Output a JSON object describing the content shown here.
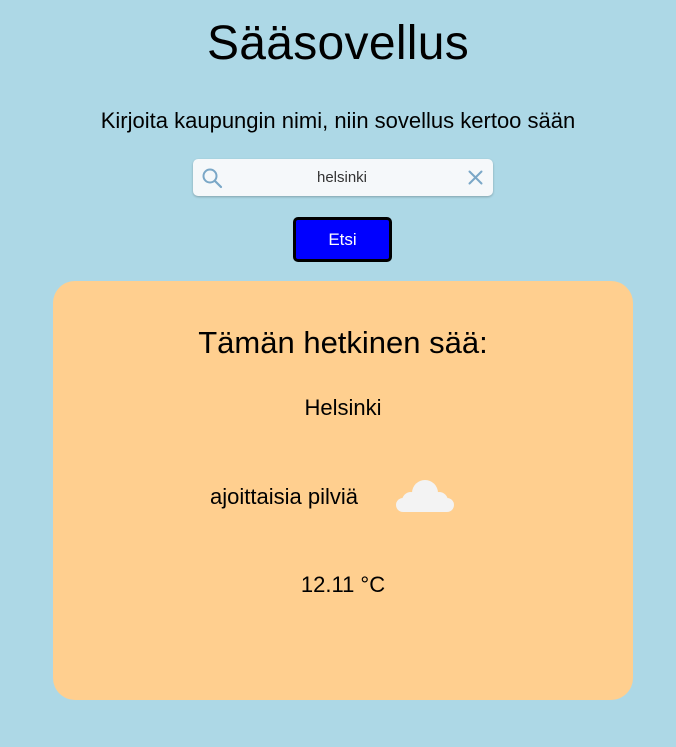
{
  "header": {
    "title": "Sääsovellus",
    "subtitle": "Kirjoita kaupungin nimi, niin sovellus kertoo sään"
  },
  "search": {
    "value": "helsinki",
    "icon": "search-icon",
    "clear_icon": "close-icon",
    "button_label": "Etsi"
  },
  "weather": {
    "heading": "Tämän hetkinen sää:",
    "city": "Helsinki",
    "condition": "ajoittaisia pilviä",
    "condition_icon": "cloud-icon",
    "temperature": "12.11 °C"
  },
  "colors": {
    "background": "#add8e6",
    "card": "#ffcf8f",
    "button": "#0000ff",
    "button_text": "#ffffff",
    "icon_accent": "#7aa7c7"
  }
}
